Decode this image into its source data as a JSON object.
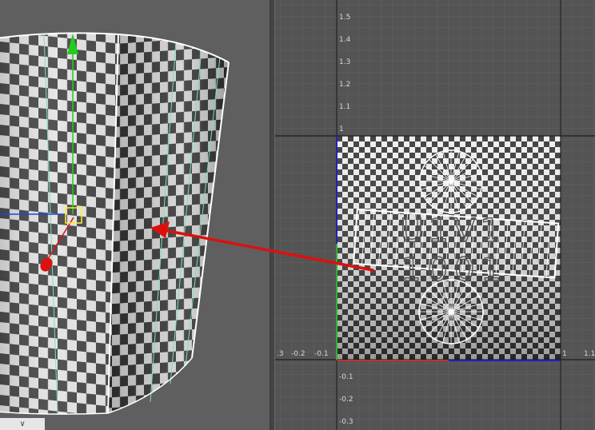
{
  "colors": {
    "viewport_bg": "#5f5f5f",
    "uv_bg": "#545454",
    "grid_minor": "#626262",
    "grid_major": "#1e1e1e",
    "checker_light": "#e4e4e4",
    "checker_dark": "#404040",
    "seam_green": "#7ee0b0",
    "edge_white": "#ffffff",
    "axis_u": "#c03030",
    "axis_v": "#2bb52b",
    "axis_blue": "#2020c0",
    "gizmo_y": "#22cc22",
    "gizmo_x": "#2244dd",
    "gizmo_z": "#dd1111",
    "pivot": "#ffee33",
    "arrow": "#dd1010"
  },
  "icons": {
    "move_gizmo": "move-gizmo-icon",
    "view_menu": "chevron-down-icon"
  },
  "viewport": {
    "view_menu_label": "∨"
  },
  "uv_editor": {
    "udim_tile_label": "U1V1",
    "udim_number_label": "1001",
    "v_axis_ticks": [
      "1.5",
      "1.4",
      "1.3",
      "1.2",
      "1.1",
      "1"
    ],
    "u_axis_ticks": [
      ".3",
      "-0.2",
      "-0.1",
      "1",
      "1.1"
    ],
    "v_negative_ticks": [
      "-0.1",
      "-0.2",
      "-0.3"
    ]
  }
}
